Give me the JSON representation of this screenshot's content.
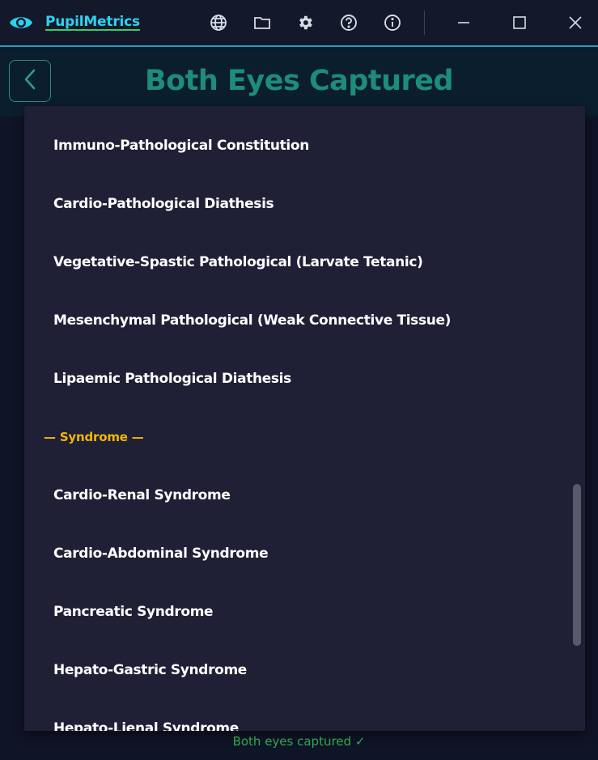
{
  "app": {
    "name": "PupilMetrics",
    "logo_icon": "eye-icon",
    "accent": "#2bd3f0",
    "underline": "#2bd36a"
  },
  "titlebar": {
    "icons": [
      "globe-icon",
      "folder-icon",
      "gear-icon",
      "help-icon",
      "info-icon"
    ],
    "window_controls": [
      "minimize-icon",
      "maximize-icon",
      "close-icon"
    ]
  },
  "header": {
    "title": "Both Eyes Captured",
    "back_icon": "chevron-left-icon",
    "title_color": "#1e8c7a"
  },
  "dropdown": {
    "items": [
      {
        "label": "Immuno-Pathological Constitution"
      },
      {
        "label": "Cardio-Pathological Diathesis"
      },
      {
        "label": "Vegetative-Spastic Pathological (Larvate Tetanic)"
      },
      {
        "label": "Mesenchymal Pathological (Weak Connective Tissue)"
      },
      {
        "label": "Lipaemic Pathological Diathesis"
      }
    ],
    "group_header": "— Syndrome —",
    "group_color": "#f2b705",
    "syndrome_items": [
      {
        "label": "Cardio-Renal Syndrome"
      },
      {
        "label": "Cardio-Abdominal Syndrome"
      },
      {
        "label": "Pancreatic Syndrome"
      },
      {
        "label": "Hepato-Gastric Syndrome"
      },
      {
        "label": "Hepato-Lienal Syndrome"
      }
    ]
  },
  "status": {
    "text": "Both eyes captured ✓",
    "color": "#2fa84f"
  }
}
